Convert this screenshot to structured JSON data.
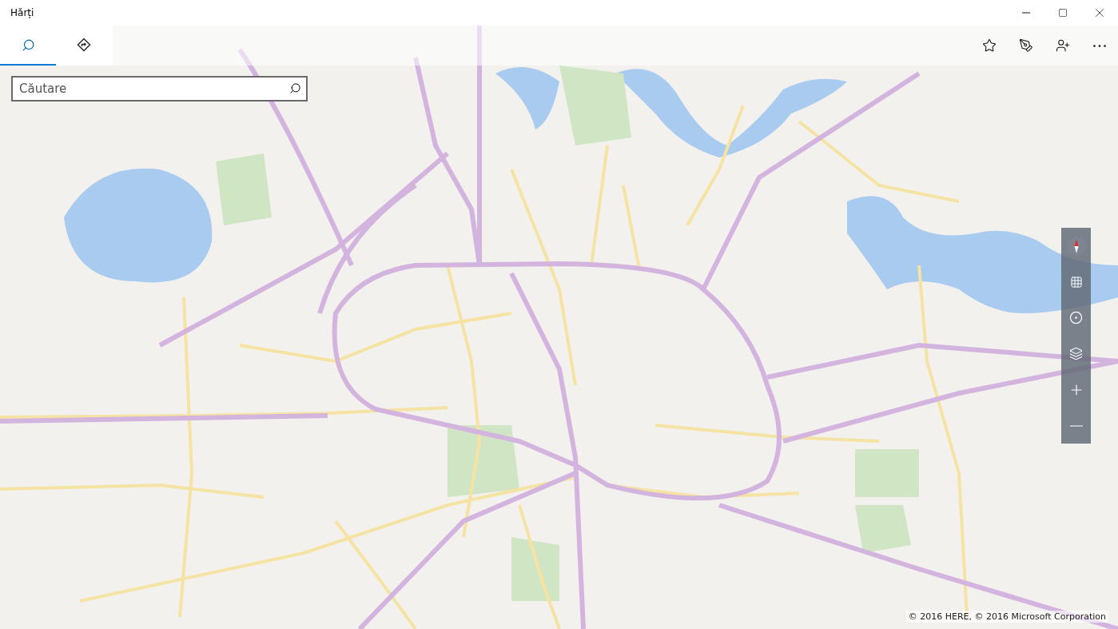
{
  "window": {
    "title": "Hărți"
  },
  "tabs": [
    {
      "kind": "search",
      "selected": true
    },
    {
      "kind": "directions",
      "selected": false
    }
  ],
  "search": {
    "placeholder": "Căutare"
  },
  "toolbar": [
    {
      "kind": "favorites"
    },
    {
      "kind": "ink"
    },
    {
      "kind": "account"
    },
    {
      "kind": "more"
    }
  ],
  "map_controls": [
    {
      "kind": "compass"
    },
    {
      "kind": "tilt"
    },
    {
      "kind": "location"
    },
    {
      "kind": "layers"
    },
    {
      "kind": "zoom_in"
    },
    {
      "kind": "zoom_out"
    }
  ],
  "copyright": "© 2016 HERE, © 2016 Microsoft Corporation"
}
